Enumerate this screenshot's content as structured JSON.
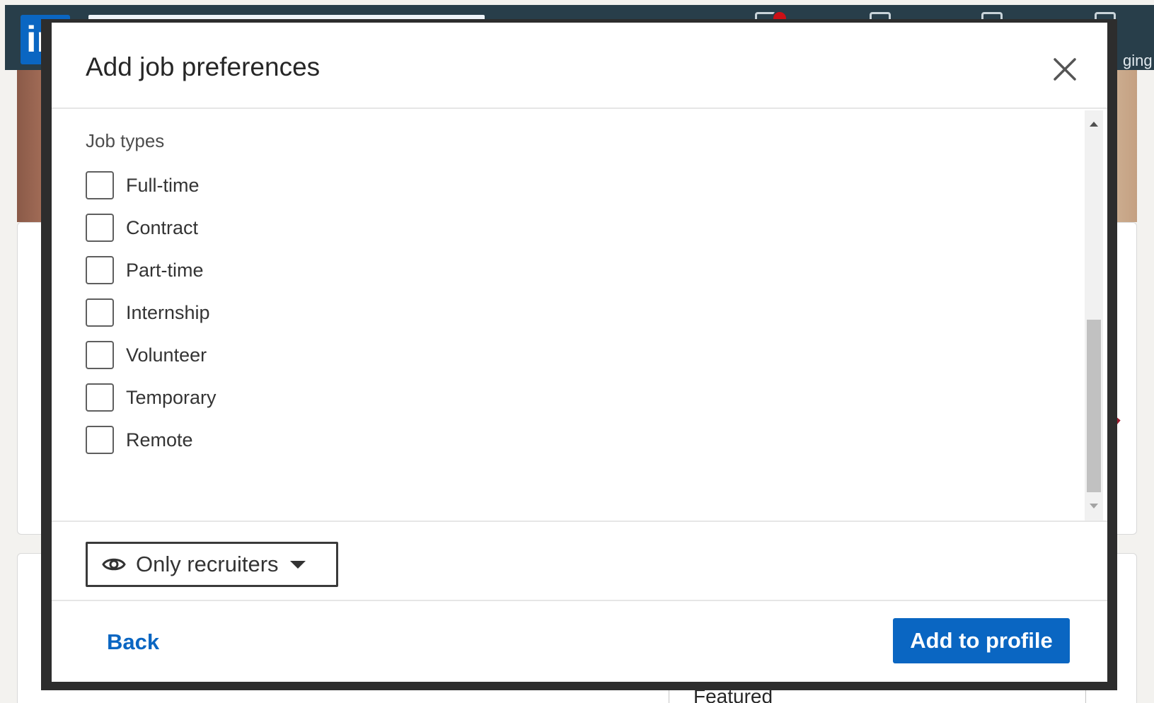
{
  "background": {
    "logo_text": "in",
    "nav_partial_label": "ging",
    "featured_label": "Featured"
  },
  "modal": {
    "title": "Add job preferences",
    "close_icon": "close-icon",
    "section_label": "Job types",
    "job_types": [
      {
        "label": "Full-time",
        "checked": false
      },
      {
        "label": "Contract",
        "checked": false
      },
      {
        "label": "Part-time",
        "checked": false
      },
      {
        "label": "Internship",
        "checked": false
      },
      {
        "label": "Volunteer",
        "checked": false
      },
      {
        "label": "Temporary",
        "checked": false
      },
      {
        "label": "Remote",
        "checked": false
      }
    ],
    "visibility": {
      "icon": "eye-icon",
      "label": "Only recruiters",
      "caret_icon": "caret-down-icon"
    },
    "footer": {
      "back_label": "Back",
      "primary_label": "Add to profile"
    }
  },
  "colors": {
    "brand_blue": "#0a66c2",
    "nav_background": "#283e4a",
    "overlay_frame": "#2d2d2d"
  }
}
